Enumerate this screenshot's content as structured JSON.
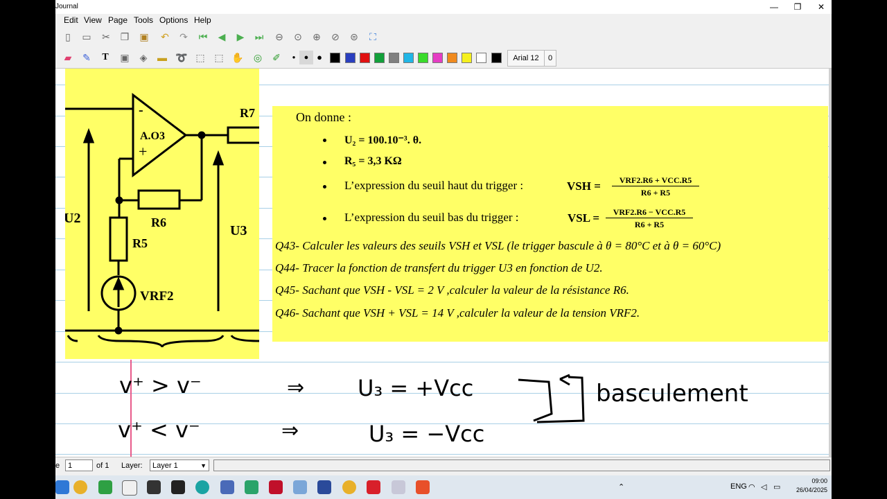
{
  "window": {
    "title": "Journal",
    "controls": {
      "minimize": "—",
      "maximize": "❐",
      "close": "✕"
    }
  },
  "menu": [
    "Edit",
    "View",
    "Page",
    "Tools",
    "Options",
    "Help"
  ],
  "toolbar2": {
    "font_label": "Arial 12",
    "font_extra": "0",
    "colors": [
      "#000000",
      "#2a3fbf",
      "#e01010",
      "#12a03a",
      "#808080",
      "#21b6e6",
      "#3adb2b",
      "#e53dc4",
      "#f08a1e",
      "#f5f01e",
      "#ffffff",
      "#000000"
    ]
  },
  "question_panel": {
    "intro": "On donne :",
    "u2": "U₂ = 100.10⁻³. θ.",
    "r5": "R₅ = 3,3 KΩ",
    "vsh_text": "L’expression du seuil haut du trigger :",
    "vsh_symbol": "VSH =",
    "vsh_num": "VRF2.R6 + VCC.R5",
    "vsh_den": "R6 + R5",
    "vsl_text": "L’expression du seuil bas du trigger :",
    "vsl_symbol": "VSL =",
    "vsl_num": "VRF2.R6 − VCC.R5",
    "vsl_den": "R6 + R5",
    "q43": "Q43- Calculer les valeurs des seuils VSH et VSL (le trigger bascule à θ = 80°C et à θ = 60°C)",
    "q44": "Q44- Tracer la fonction de transfert du trigger U3 en fonction de U2.",
    "q45": "Q45- Sachant que VSH - VSL = 2 V ,calculer la valeur de la résistance R6.",
    "q46": "Q46- Sachant que VSH + VSL = 14 V ,calculer la valeur de la tension VRF2."
  },
  "circuit": {
    "opamp_label": "A.O3",
    "minus": "-",
    "plus": "+",
    "r7": "R7",
    "r6": "R6",
    "r5": "R5",
    "u2": "U2",
    "u3": "U3",
    "vrf2": "VRF2"
  },
  "handwriting": {
    "line1_left": "v⁺ > v⁻",
    "line1_arrow": "⇒",
    "line1_right": "U₃ = +Vcc",
    "line2_left": "v⁺ < v⁻",
    "line2_arrow": "⇒",
    "line2_right": "U₃ = −Vcc",
    "note": "basculement"
  },
  "status": {
    "page_prefix": "e",
    "page_value": "1",
    "page_of": "of 1",
    "layer_label": "Layer:",
    "layer_value": "Layer 1"
  },
  "taskbar": {
    "lang": "ENG",
    "time": "09:00",
    "date": "26/04/2025"
  }
}
